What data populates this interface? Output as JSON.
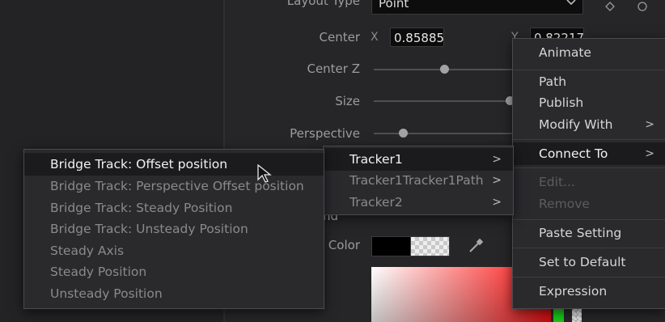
{
  "inspector": {
    "layout_type_label": "Layout Type",
    "layout_type_value": "Point",
    "center_label": "Center",
    "center_x_axis": "X",
    "center_x_value": "0.85885",
    "center_y_axis": "Y",
    "center_y_value": "0.82217",
    "center_z_label": "Center Z",
    "size_label": "Size",
    "perspective_label": "Perspective",
    "section_fragment": "nd",
    "color_label": "Color"
  },
  "context_menu": {
    "items": [
      {
        "label": "Animate"
      },
      {
        "label": "Path"
      },
      {
        "label": "Publish"
      },
      {
        "label": "Modify With",
        "arrow": ">"
      },
      {
        "label": "Connect To",
        "arrow": ">"
      },
      {
        "label": "Edit..."
      },
      {
        "label": "Remove"
      },
      {
        "label": "Paste Setting"
      },
      {
        "label": "Set to Default"
      },
      {
        "label": "Expression"
      }
    ]
  },
  "tracker_menu": {
    "items": [
      {
        "label": "Tracker1",
        "arrow": ">"
      },
      {
        "label": "Tracker1Tracker1Path",
        "arrow": ">"
      },
      {
        "label": "Tracker2",
        "arrow": ">"
      }
    ]
  },
  "bridge_menu": {
    "items": [
      {
        "label": "Bridge Track: Offset position"
      },
      {
        "label": "Bridge Track: Perspective Offset position"
      },
      {
        "label": "Bridge Track: Steady Position"
      },
      {
        "label": "Bridge Track: Unsteady Position"
      },
      {
        "label": "Steady Axis"
      },
      {
        "label": "Steady Position"
      },
      {
        "label": "Unsteady Position"
      }
    ]
  },
  "sliders": {
    "center_z": 0.45,
    "size": 0.95,
    "perspective": 0.2
  },
  "colors": {
    "highlight_row": "#1b1b1d",
    "menu_bg": "#2a2a2d",
    "green_swatch": "#18c818"
  },
  "icons": [
    "chevron-down-icon",
    "keyframe-diamond-icon",
    "reset-icon",
    "eyedropper-icon",
    "cursor-arrow-icon"
  ]
}
